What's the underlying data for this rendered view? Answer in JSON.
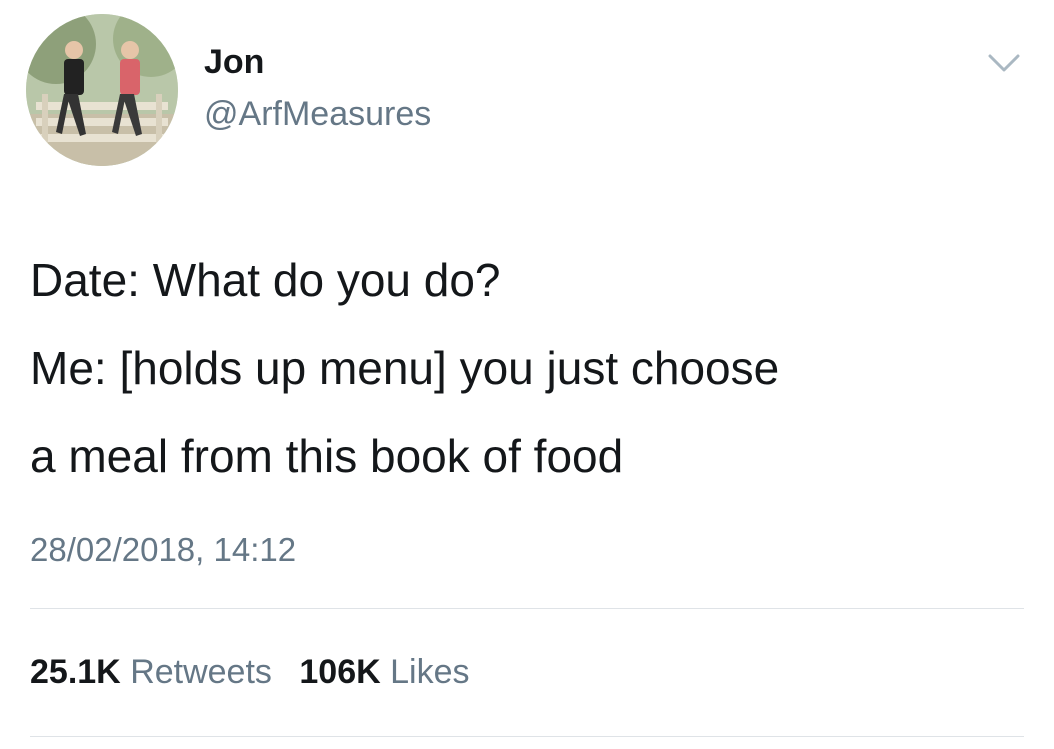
{
  "author": {
    "display_name": "Jon",
    "handle": "@ArfMeasures",
    "avatar_icon": "profile-photo"
  },
  "menu_icon": "chevron-down-icon",
  "tweet": {
    "lines": [
      "Date: What do you do?",
      "Me: [holds up menu] you just choose",
      "a meal from this book of food"
    ],
    "timestamp": "28/02/2018, 14:12"
  },
  "stats": {
    "retweets_count": "25.1K",
    "retweets_label": "Retweets",
    "likes_count": "106K",
    "likes_label": "Likes"
  },
  "colors": {
    "text": "#14171a",
    "secondary": "#657786",
    "divider": "#dfe3e7"
  }
}
